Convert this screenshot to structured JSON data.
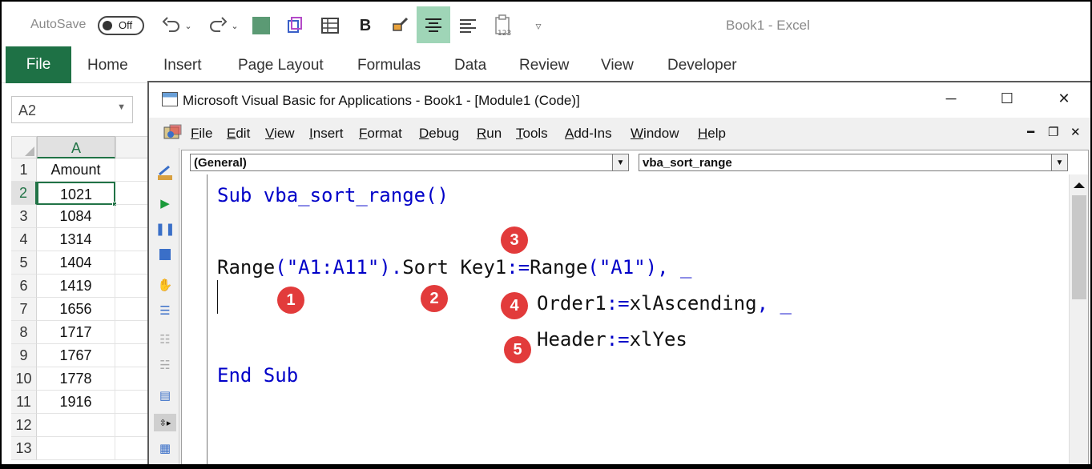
{
  "excel": {
    "autosave_label": "AutoSave",
    "autosave_state": "Off",
    "window_title": "Book1  -  Excel",
    "quick_access_icons": [
      "undo-icon",
      "redo-icon",
      "fill-color-icon",
      "3d-box-icon",
      "table-icon",
      "bold-icon",
      "format-painter-icon",
      "align-center-icon",
      "align-left-icon",
      "clipboard-123-icon",
      "customize-chevron-icon"
    ],
    "quick_access_bold": "B",
    "tabs": [
      "File",
      "Home",
      "Insert",
      "Page Layout",
      "Formulas",
      "Data",
      "Review",
      "View",
      "Developer"
    ],
    "name_box": "A2",
    "column_header": "A",
    "rows": [
      {
        "num": "1",
        "value": "Amount"
      },
      {
        "num": "2",
        "value": "1021"
      },
      {
        "num": "3",
        "value": "1084"
      },
      {
        "num": "4",
        "value": "1314"
      },
      {
        "num": "5",
        "value": "1404"
      },
      {
        "num": "6",
        "value": "1419"
      },
      {
        "num": "7",
        "value": "1656"
      },
      {
        "num": "8",
        "value": "1717"
      },
      {
        "num": "9",
        "value": "1767"
      },
      {
        "num": "10",
        "value": "1778"
      },
      {
        "num": "11",
        "value": "1916"
      },
      {
        "num": "12",
        "value": ""
      },
      {
        "num": "13",
        "value": ""
      }
    ]
  },
  "vbe": {
    "title": "Microsoft Visual Basic for Applications - Book1 - [Module1 (Code)]",
    "window_buttons": {
      "minimize": "─",
      "maximize": "☐",
      "close": "✕"
    },
    "menu": [
      {
        "label": "File"
      },
      {
        "label": "Edit"
      },
      {
        "label": "View"
      },
      {
        "label": "Insert"
      },
      {
        "label": "Format"
      },
      {
        "label": "Debug"
      },
      {
        "label": "Run"
      },
      {
        "label": "Tools"
      },
      {
        "label": "Add-Ins"
      },
      {
        "label": "Window"
      },
      {
        "label": "Help"
      }
    ],
    "mdi_buttons": {
      "minimize": "━",
      "restore": "❐",
      "close": "✕"
    },
    "object_combo": "(General)",
    "procedure_combo": "vba_sort_range",
    "code": {
      "line1_kw": "Sub",
      "line1_rest": " vba_sort_range()",
      "line3_range": "Range(\"A1:A11\").Sort Key1:=Range(\"A1\"), _",
      "line4": "Order1:=xlAscending, _",
      "line5": "Header:=xlYes",
      "line7": "End Sub"
    },
    "badges": [
      "1",
      "2",
      "3",
      "4",
      "5"
    ]
  }
}
